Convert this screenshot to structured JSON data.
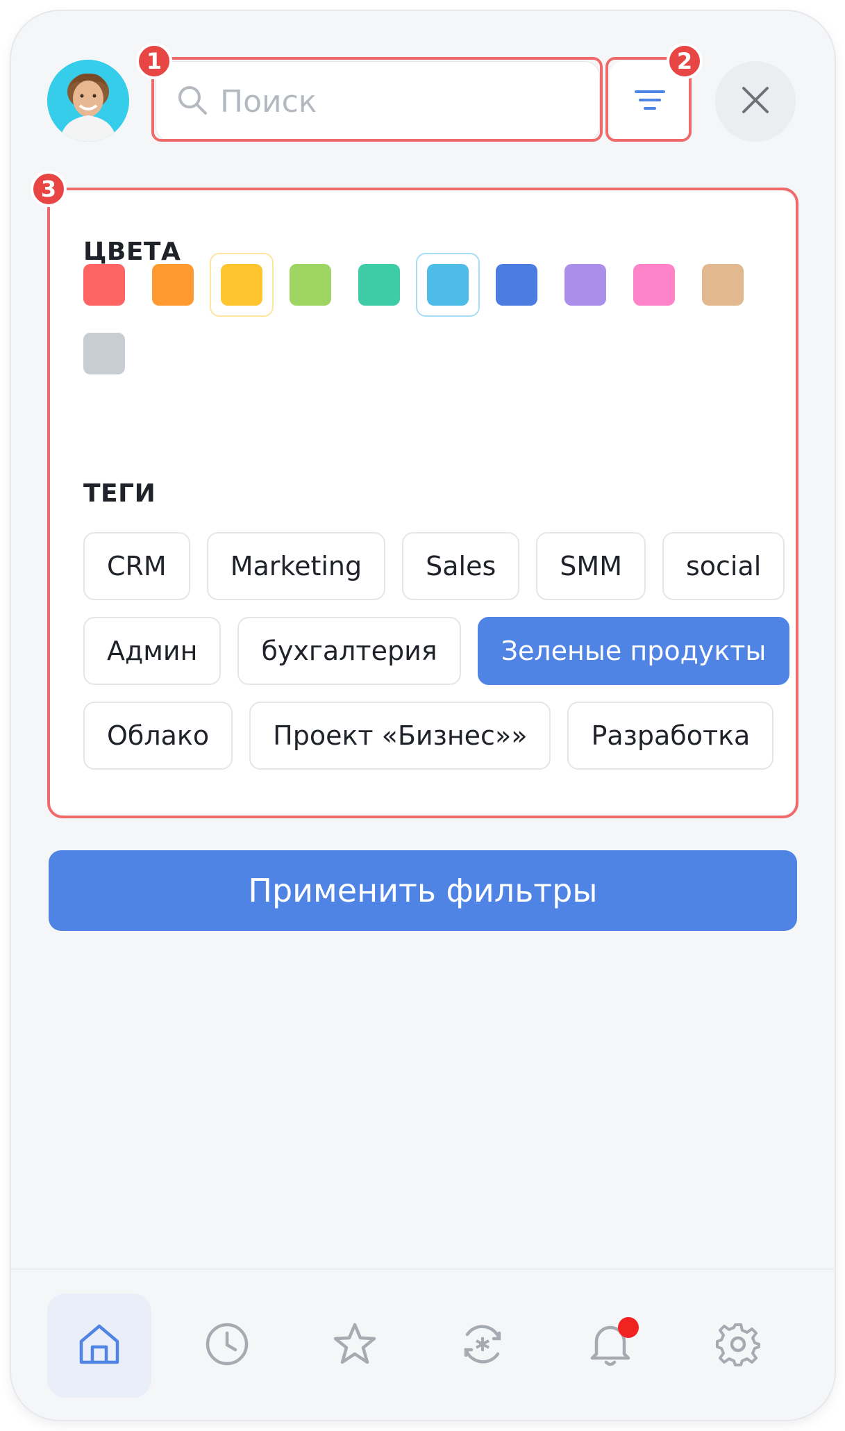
{
  "header": {
    "avatar_alt": "user-avatar",
    "search_placeholder": "Поиск",
    "filter_icon": "filter-icon",
    "close_icon": "close-icon"
  },
  "filters": {
    "colors_title": "ЦВЕТА",
    "colors": [
      {
        "hex": "#ff6464",
        "selected": false
      },
      {
        "hex": "#ff9a30",
        "selected": false
      },
      {
        "hex": "#ffc52e",
        "selected": true,
        "ring": "#ffe4a3"
      },
      {
        "hex": "#9ed461",
        "selected": false
      },
      {
        "hex": "#3dcca5",
        "selected": false
      },
      {
        "hex": "#4dbde8",
        "selected": true,
        "ring": "#a7ddf2"
      },
      {
        "hex": "#4b7de0",
        "selected": false
      },
      {
        "hex": "#a98fea",
        "selected": false
      },
      {
        "hex": "#ff83c8",
        "selected": false
      },
      {
        "hex": "#e2b88f",
        "selected": false
      },
      {
        "hex": "#c8cdd4",
        "selected": false
      }
    ],
    "tags_title": "ТЕГИ",
    "tags": [
      {
        "label": "CRM",
        "active": false
      },
      {
        "label": "Marketing",
        "active": false
      },
      {
        "label": "Sales",
        "active": false
      },
      {
        "label": "SMM",
        "active": false
      },
      {
        "label": "social",
        "active": false
      },
      {
        "label": "Админ",
        "active": false
      },
      {
        "label": "бухгалтерия",
        "active": false
      },
      {
        "label": "Зеленые продукты",
        "active": true
      },
      {
        "label": "Облако",
        "active": false
      },
      {
        "label": "Проект «Бизнес»»",
        "active": false
      },
      {
        "label": "Разработка",
        "active": false
      }
    ],
    "apply_label": "Применить фильтры"
  },
  "annotations": [
    "1",
    "2",
    "3"
  ],
  "nav": [
    {
      "icon": "home-icon",
      "active": true
    },
    {
      "icon": "clock-icon",
      "active": false
    },
    {
      "icon": "star-icon",
      "active": false
    },
    {
      "icon": "sync-asterisk-icon",
      "active": false
    },
    {
      "icon": "bell-icon",
      "active": false,
      "notification": true
    },
    {
      "icon": "gear-icon",
      "active": false
    }
  ],
  "colors": {
    "accent": "#4f83e4",
    "highlight": "#ef6b6b",
    "badge": "#e84545"
  }
}
